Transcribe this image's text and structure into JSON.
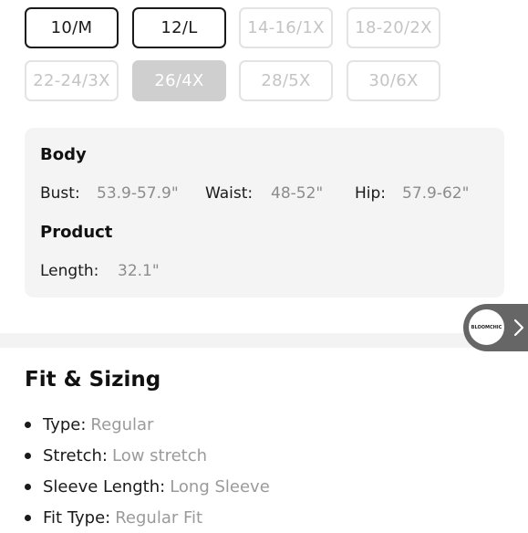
{
  "size_options": [
    {
      "label": "10/M",
      "state": "available"
    },
    {
      "label": "12/L",
      "state": "available"
    },
    {
      "label": "14-16/1X",
      "state": "unavailable"
    },
    {
      "label": "18-20/2X",
      "state": "unavailable"
    },
    {
      "label": "22-24/3X",
      "state": "unavailable"
    },
    {
      "label": "26/4X",
      "state": "selected"
    },
    {
      "label": "28/5X",
      "state": "unavailable"
    },
    {
      "label": "30/6X",
      "state": "unavailable"
    }
  ],
  "measurements": {
    "body_heading": "Body",
    "bust_label": "Bust:",
    "bust_value": "53.9-57.9\"",
    "waist_label": "Waist:",
    "waist_value": "48-52\"",
    "hip_label": "Hip:",
    "hip_value": "57.9-62\"",
    "product_heading": "Product",
    "length_label": "Length:",
    "length_value": "32.1\""
  },
  "floating_tab": {
    "logo_text": "BLOOMCHIC",
    "icon": "chevron-right-icon"
  },
  "fit_sizing": {
    "title": "Fit & Sizing",
    "items": [
      {
        "key": "Type:",
        "value": "Regular"
      },
      {
        "key": "Stretch:",
        "value": "Low stretch"
      },
      {
        "key": "Sleeve Length:",
        "value": "Long Sleeve"
      },
      {
        "key": "Fit Type:",
        "value": "Regular Fit"
      }
    ]
  },
  "colors": {
    "text_dark": "#1a1a1a",
    "muted_value": "#8c8c8c",
    "panel_bg": "#f4f4f4",
    "selected_bg": "#cfcfcf",
    "tab_bg": "#666666"
  }
}
